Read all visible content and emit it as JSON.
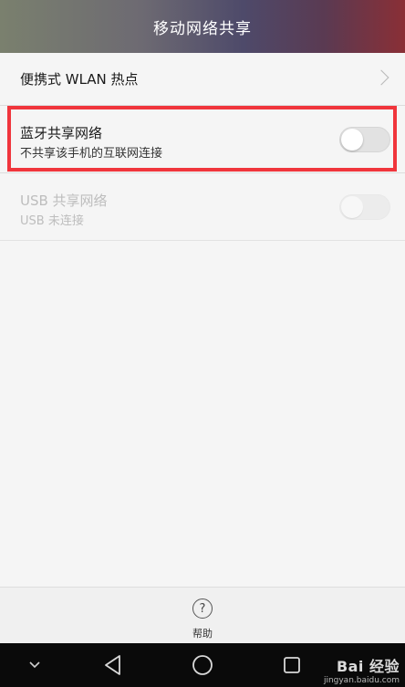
{
  "header": {
    "title": "移动网络共享"
  },
  "settings": {
    "wlan_hotspot": {
      "title": "便携式 WLAN 热点"
    },
    "bluetooth": {
      "title": "蓝牙共享网络",
      "subtitle": "不共享该手机的互联网连接",
      "toggle_on": false
    },
    "usb": {
      "title": "USB 共享网络",
      "subtitle": "USB 未连接",
      "toggle_on": false,
      "disabled": true
    }
  },
  "help": {
    "label": "帮助",
    "icon": "?"
  },
  "navbar": {
    "icons": [
      "chevron-down-icon",
      "back-icon",
      "home-icon",
      "recent-apps-icon"
    ]
  },
  "watermark": {
    "brand": "Bai 经验",
    "url": "jingyan.baidu.com"
  },
  "colors": {
    "highlight": "#f0353c",
    "header_start": "#7a806e",
    "header_end": "#8a2f36"
  }
}
